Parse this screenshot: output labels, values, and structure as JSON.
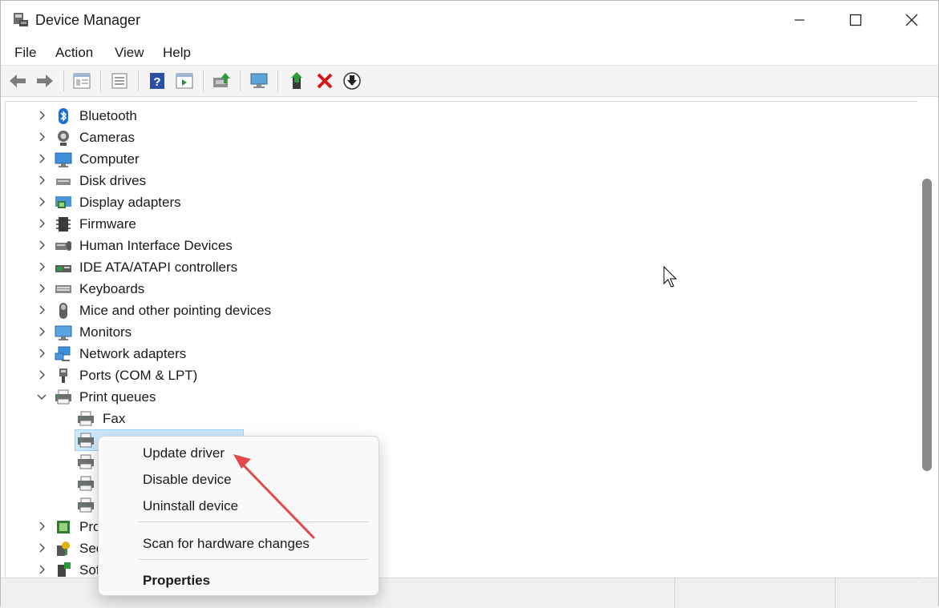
{
  "window": {
    "title": "Device Manager"
  },
  "menu": [
    "File",
    "Action",
    "View",
    "Help"
  ],
  "toolbar": {
    "buttons": [
      "back-icon",
      "forward-icon",
      "show-hide-tree-icon",
      "properties-icon",
      "help-icon",
      "action-pane-icon",
      "update-driver-icon",
      "scan-hardware-icon",
      "enable-device-icon",
      "uninstall-icon",
      "disable-download-icon"
    ]
  },
  "tree": {
    "categories": [
      {
        "label": "Bluetooth",
        "icon": "bluetooth-icon",
        "expanded": false
      },
      {
        "label": "Cameras",
        "icon": "camera-icon",
        "expanded": false
      },
      {
        "label": "Computer",
        "icon": "computer-icon",
        "expanded": false
      },
      {
        "label": "Disk drives",
        "icon": "disk-drive-icon",
        "expanded": false
      },
      {
        "label": "Display adapters",
        "icon": "display-adapter-icon",
        "expanded": false
      },
      {
        "label": "Firmware",
        "icon": "firmware-icon",
        "expanded": false
      },
      {
        "label": "Human Interface Devices",
        "icon": "hid-icon",
        "expanded": false
      },
      {
        "label": "IDE ATA/ATAPI controllers",
        "icon": "ide-controller-icon",
        "expanded": false
      },
      {
        "label": "Keyboards",
        "icon": "keyboard-icon",
        "expanded": false
      },
      {
        "label": "Mice and other pointing devices",
        "icon": "mouse-icon",
        "expanded": false
      },
      {
        "label": "Monitors",
        "icon": "monitor-icon",
        "expanded": false
      },
      {
        "label": "Network adapters",
        "icon": "network-adapter-icon",
        "expanded": false
      },
      {
        "label": "Ports (COM & LPT)",
        "icon": "port-icon",
        "expanded": false
      },
      {
        "label": "Print queues",
        "icon": "printer-icon",
        "expanded": true
      }
    ],
    "print_queue_children": [
      "Fax",
      "",
      "",
      "",
      ""
    ],
    "trailing_categories": [
      "Pro",
      "Sec",
      "Sof"
    ]
  },
  "context_menu": {
    "items": [
      "Update driver",
      "Disable device",
      "Uninstall device",
      "Scan for hardware changes",
      "Properties"
    ]
  },
  "colors": {
    "selection": "#cce8ff",
    "selection_border": "#99d1ff",
    "annotation_arrow": "#e24a4a"
  }
}
